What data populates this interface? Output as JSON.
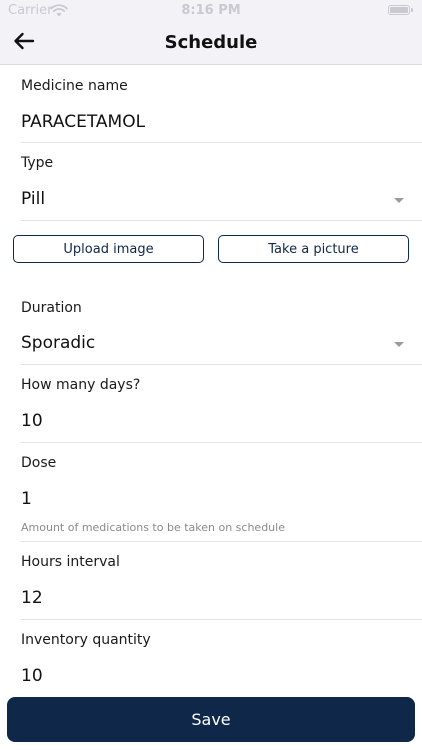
{
  "status_bar": {
    "carrier": "Carrier",
    "time": "8:16 PM"
  },
  "nav": {
    "title": "Schedule",
    "back_icon": "arrow-left-icon"
  },
  "form": {
    "medicine_name": {
      "label": "Medicine name",
      "value": "PARACETAMOL"
    },
    "type": {
      "label": "Type",
      "value": "Pill"
    },
    "upload_image_label": "Upload image",
    "take_picture_label": "Take a picture",
    "duration": {
      "label": "Duration",
      "value": "Sporadic"
    },
    "days": {
      "label": "How many days?",
      "value": "10"
    },
    "dose": {
      "label": "Dose",
      "value": "1",
      "helper": "Amount of medications to be taken on schedule"
    },
    "hours_interval": {
      "label": "Hours interval",
      "value": "12"
    },
    "inventory": {
      "label": "Inventory quantity",
      "value": "10"
    }
  },
  "save_label": "Save",
  "colors": {
    "primary": "#0f2748",
    "nav_background": "#f2f2f7",
    "divider": "#e3e3e8",
    "helper_text": "#8a8a8f"
  }
}
